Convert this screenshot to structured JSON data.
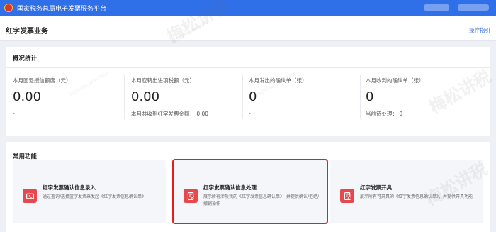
{
  "topbar": {
    "title": "国家税务总局电子发票服务平台"
  },
  "header": {
    "title": "红字发票业务",
    "guide_link": "操作指引"
  },
  "overview": {
    "title": "概况统计",
    "stats": [
      {
        "label": "本月回退授信额度（元）",
        "value": "0.00",
        "note": "-"
      },
      {
        "label": "本月应转出进项税额（元）",
        "value": "0.00",
        "note": "本月共收到红字发票金额： 0.00"
      },
      {
        "label": "本月发出的确认单（张）",
        "value": "0",
        "note": "-"
      },
      {
        "label": "本月收到的确认单（张）",
        "value": "0",
        "note": "当前待处理： 0"
      }
    ]
  },
  "functions": {
    "title": "常用功能",
    "cards": [
      {
        "title": "红字发票确认信息录入",
        "desc": "通过查询/选择蓝字发票来发起《红字发票信息确认单》"
      },
      {
        "title": "红字发票确认信息处理",
        "desc": "展示所有涉及我的《红字发票信息确认单》，并提供确认/拒绝/撤销操作"
      },
      {
        "title": "红字发票开具",
        "desc": "展示所有可开具的《红字发票信息确认单》，并提供开具功能"
      }
    ]
  },
  "watermark": {
    "text": "梅松讲税",
    "sub": "MEISONG JIANGSHUI"
  },
  "colors": {
    "brand_blue": "#2f6fe8",
    "icon_red": "#e5484d",
    "highlight_red": "#e02020"
  }
}
